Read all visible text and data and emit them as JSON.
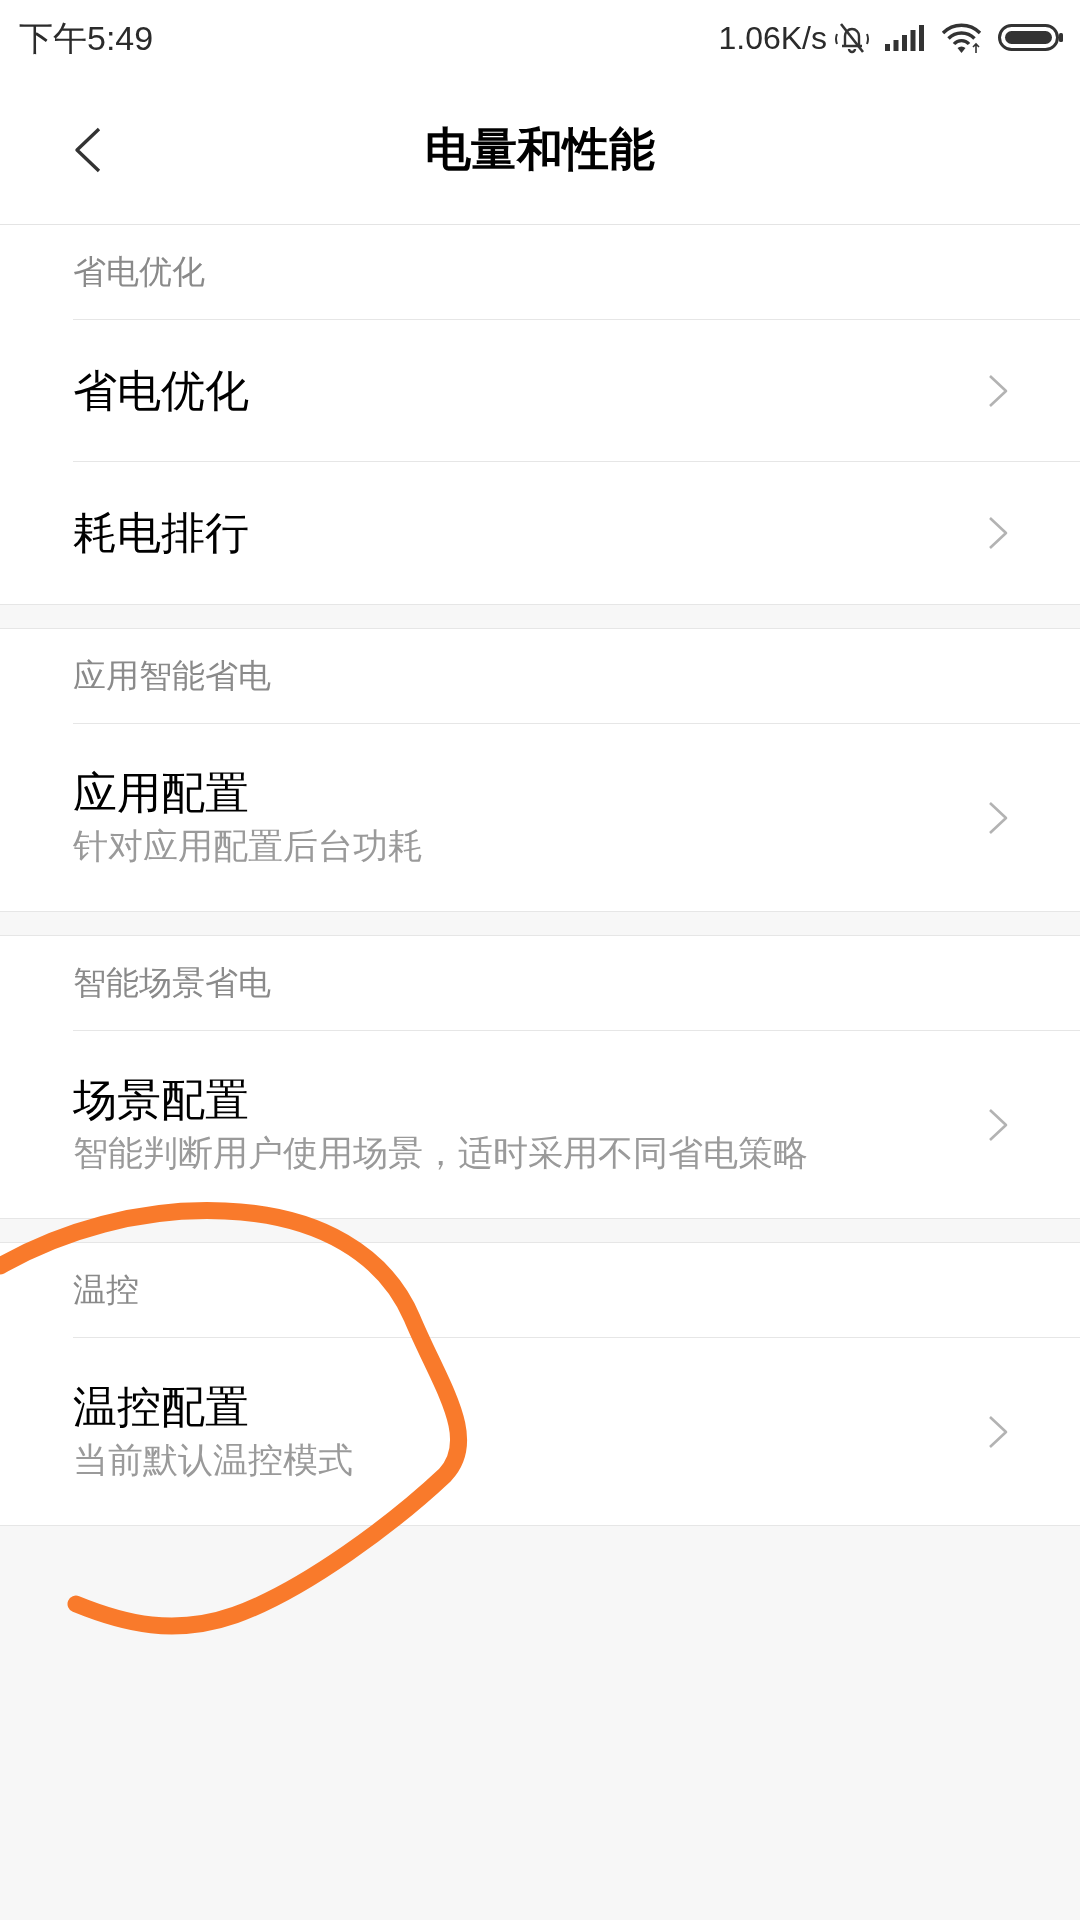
{
  "status_bar": {
    "time": "下午5:49",
    "net_speed": "1.06K/s"
  },
  "header": {
    "title": "电量和性能"
  },
  "sections": [
    {
      "title": "省电优化",
      "items": [
        {
          "title": "省电优化"
        },
        {
          "title": "耗电排行"
        }
      ]
    },
    {
      "title": "应用智能省电",
      "items": [
        {
          "title": "应用配置",
          "subtitle": "针对应用配置后台功耗"
        }
      ]
    },
    {
      "title": "智能场景省电",
      "items": [
        {
          "title": "场景配置",
          "subtitle": "智能判断用户使用场景，适时采用不同省电策略"
        }
      ]
    },
    {
      "title": "温控",
      "items": [
        {
          "title": "温控配置",
          "subtitle": "当前默认温控模式"
        }
      ]
    }
  ],
  "annotation": {
    "kind": "loop"
  }
}
